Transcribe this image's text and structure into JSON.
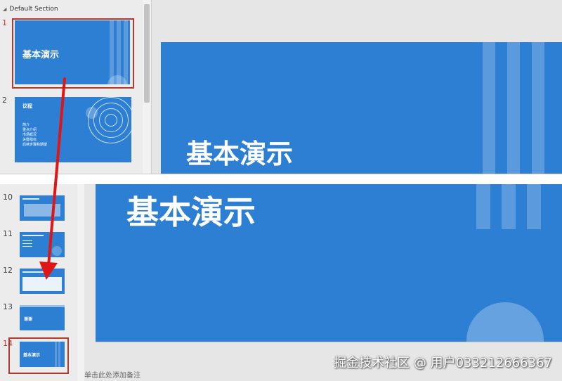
{
  "top_pane": {
    "section_header": "Default Section",
    "thumbnails": [
      {
        "number": "1",
        "title": "基本演示"
      },
      {
        "number": "2",
        "title": "议程",
        "items": [
          "简介",
          "重点介绍",
          "市场概况",
          "关键指标",
          "后续步骤和期望"
        ]
      }
    ],
    "slide_title": "基本演示"
  },
  "bottom_pane": {
    "thumbnails": [
      {
        "number": "10"
      },
      {
        "number": "11"
      },
      {
        "number": "12"
      },
      {
        "number": "13",
        "title": "谢谢"
      },
      {
        "number": "14",
        "title": "基本演示"
      }
    ],
    "slide_title": "基本演示",
    "notes_placeholder": "单击此处添加备注"
  },
  "watermark": "掘金技术社区 @ 用户033212666367",
  "colors": {
    "slide_blue": "#2d7fd4",
    "selection_red": "#b03a2e",
    "arrow_red": "#e01515"
  }
}
